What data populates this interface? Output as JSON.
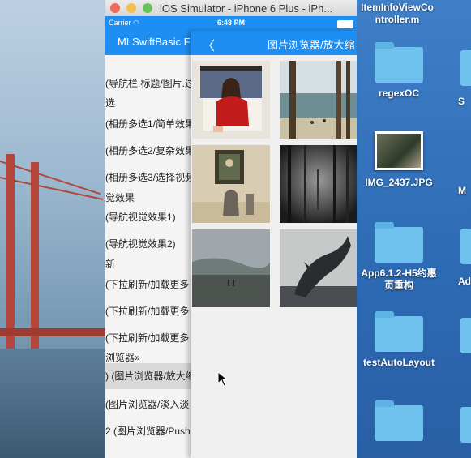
{
  "simulator": {
    "title": "iOS Simulator - iPhone 6 Plus - iPh...",
    "status": {
      "carrier": "Carrier",
      "wifi_icon": "wifi-icon",
      "time": "6:48 PM"
    }
  },
  "left_screen": {
    "nav_title": "MLSwiftBasic F",
    "rows": [
      "(导航栏.标题/图片.过",
      "选",
      "(相册多选1/简单效果",
      "(相册多选2/复杂效果",
      "(相册多选3/选择视频",
      "觉效果",
      "(导航视觉效果1)",
      "(导航视觉效果2)",
      "新",
      "(下拉刷新/加载更多",
      "(下拉刷新/加载更多",
      "(下拉刷新/加载更多",
      "浏览器»",
      ") (图片浏览器/放大缩",
      "  (图片浏览器/淡入淡",
      "2 (图片浏览器/Push"
    ]
  },
  "right_screen": {
    "nav_title": "图片浏览器/放大缩",
    "back_icon": "chevron-left-icon"
  },
  "desktop": {
    "items": [
      {
        "label": "ItemInfoViewController.m",
        "line1": "ItemInfoViewCo",
        "line2": "ntroller.m",
        "icon": "file-icon"
      },
      {
        "label": "regexOC",
        "icon": "folder-icon"
      },
      {
        "label": "IMG_2437.JPG",
        "icon": "image-thumbnail-icon"
      },
      {
        "label": "App6.1.2-H5约惠页重构",
        "line1": "App6.1.2-H5约惠",
        "line2": "页重构",
        "icon": "folder-icon"
      },
      {
        "label": "testAutoLayout",
        "icon": "folder-icon"
      }
    ],
    "edge_labels": [
      "S",
      "M",
      "Add"
    ]
  }
}
